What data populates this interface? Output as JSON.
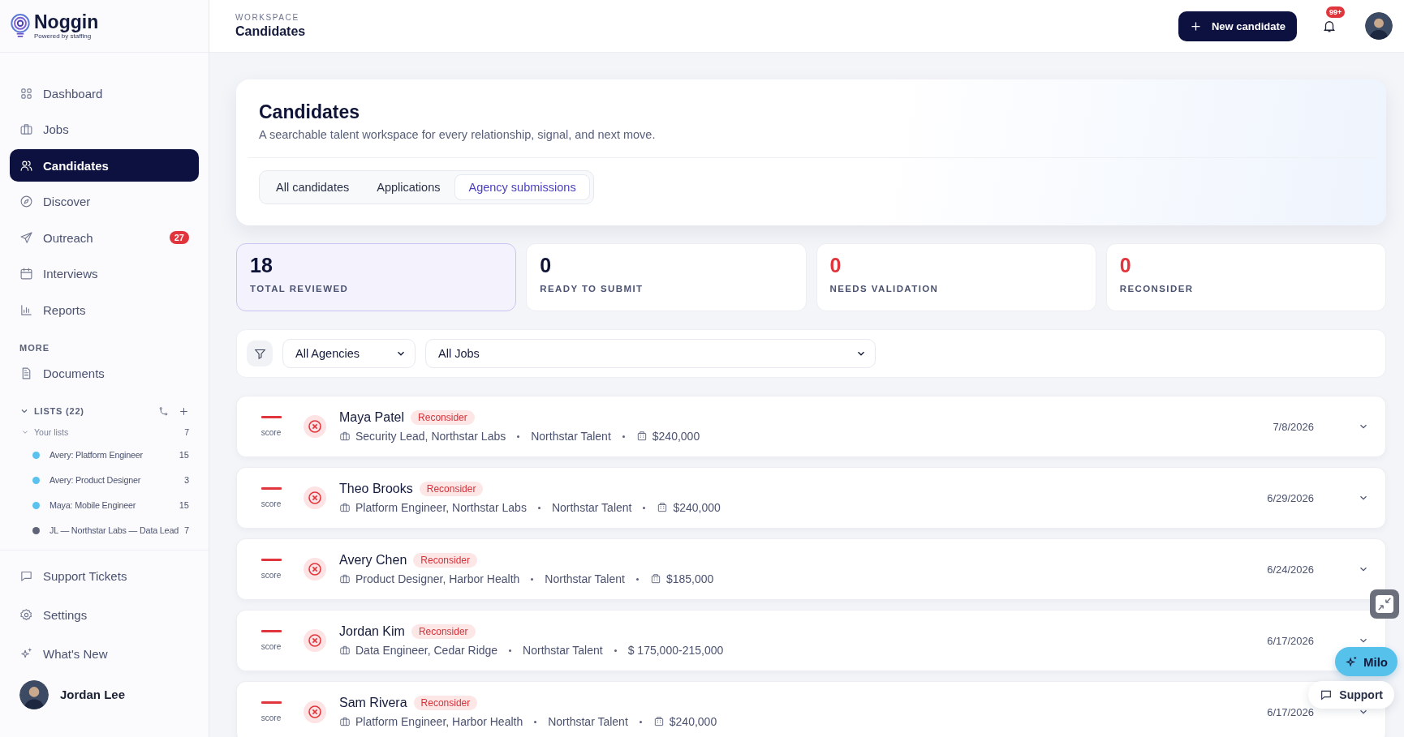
{
  "brand": {
    "name": "Noggin",
    "tagline": "Powered by staffing"
  },
  "nav": [
    {
      "label": "Dashboard",
      "selected": false
    },
    {
      "label": "Jobs",
      "selected": false
    },
    {
      "label": "Candidates",
      "selected": true
    },
    {
      "label": "Discover",
      "selected": false
    },
    {
      "label": "Outreach",
      "selected": false,
      "badge": "27"
    },
    {
      "label": "Interviews",
      "selected": false
    },
    {
      "label": "Reports",
      "selected": false
    }
  ],
  "more": {
    "title": "MORE",
    "items": [
      {
        "label": "Documents",
        "selected": false
      }
    ]
  },
  "lists": {
    "title": "LISTS (22)",
    "groups": [
      {
        "label": "Your lists",
        "count": "7",
        "children": [
          {
            "label": "Avery: Platform Engineer",
            "count": "15",
            "color": "#5bc2f0"
          },
          {
            "label": "Avery: Product Designer",
            "count": "3",
            "color": "#5bc2f0"
          },
          {
            "label": "Maya: Mobile Engineer",
            "count": "15",
            "color": "#5bc2f0"
          },
          {
            "label": "JL — Northstar Labs — Data Lead",
            "count": "7",
            "color": "#5f6478"
          }
        ]
      }
    ]
  },
  "footer_nav": [
    {
      "label": "Support Tickets"
    },
    {
      "label": "Settings"
    },
    {
      "label": "What's New"
    }
  ],
  "user": {
    "name": "Jordan Lee"
  },
  "header": {
    "eyebrow": "WORKSPACE",
    "title": "Candidates",
    "new_button": "New candidate",
    "notification_badge": "99+"
  },
  "hero": {
    "title": "Candidates",
    "subtitle": "A searchable talent workspace for every relationship, signal, and next move.",
    "tabs": [
      {
        "label": "All candidates",
        "selected": false
      },
      {
        "label": "Applications",
        "selected": false
      },
      {
        "label": "Agency submissions",
        "selected": true
      }
    ]
  },
  "stats": [
    {
      "value": "18",
      "label": "TOTAL REVIEWED",
      "selected": true,
      "alert": false
    },
    {
      "value": "0",
      "label": "READY TO SUBMIT",
      "selected": false,
      "alert": false
    },
    {
      "value": "0",
      "label": "NEEDS VALIDATION",
      "selected": false,
      "alert": true
    },
    {
      "value": "0",
      "label": "RECONSIDER",
      "selected": false,
      "alert": true
    }
  ],
  "filters": {
    "agency": "All Agencies",
    "job": "All Jobs"
  },
  "candidates": [
    {
      "score_label": "score",
      "name": "Maya Patel",
      "status": "Reconsider",
      "role": "Security Lead, Northstar Labs",
      "agency": "Northstar Talent",
      "salary": "$240,000",
      "salary_icon": true,
      "date": "7/8/2026"
    },
    {
      "score_label": "score",
      "name": "Theo Brooks",
      "status": "Reconsider",
      "role": "Platform Engineer, Northstar Labs",
      "agency": "Northstar Talent",
      "salary": "$240,000",
      "salary_icon": true,
      "date": "6/29/2026"
    },
    {
      "score_label": "score",
      "name": "Avery Chen",
      "status": "Reconsider",
      "role": "Product Designer, Harbor Health",
      "agency": "Northstar Talent",
      "salary": "$185,000",
      "salary_icon": true,
      "date": "6/24/2026"
    },
    {
      "score_label": "score",
      "name": "Jordan Kim",
      "status": "Reconsider",
      "role": "Data Engineer, Cedar Ridge",
      "agency": "Northstar Talent",
      "salary": "$ 175,000-215,000",
      "salary_icon": false,
      "date": "6/17/2026"
    },
    {
      "score_label": "score",
      "name": "Sam Rivera",
      "status": "Reconsider",
      "role": "Platform Engineer, Harbor Health",
      "agency": "Northstar Talent",
      "salary": "$240,000",
      "salary_icon": true,
      "date": "6/17/2026"
    }
  ],
  "floating": {
    "assistant": "Milo",
    "support": "Support"
  }
}
